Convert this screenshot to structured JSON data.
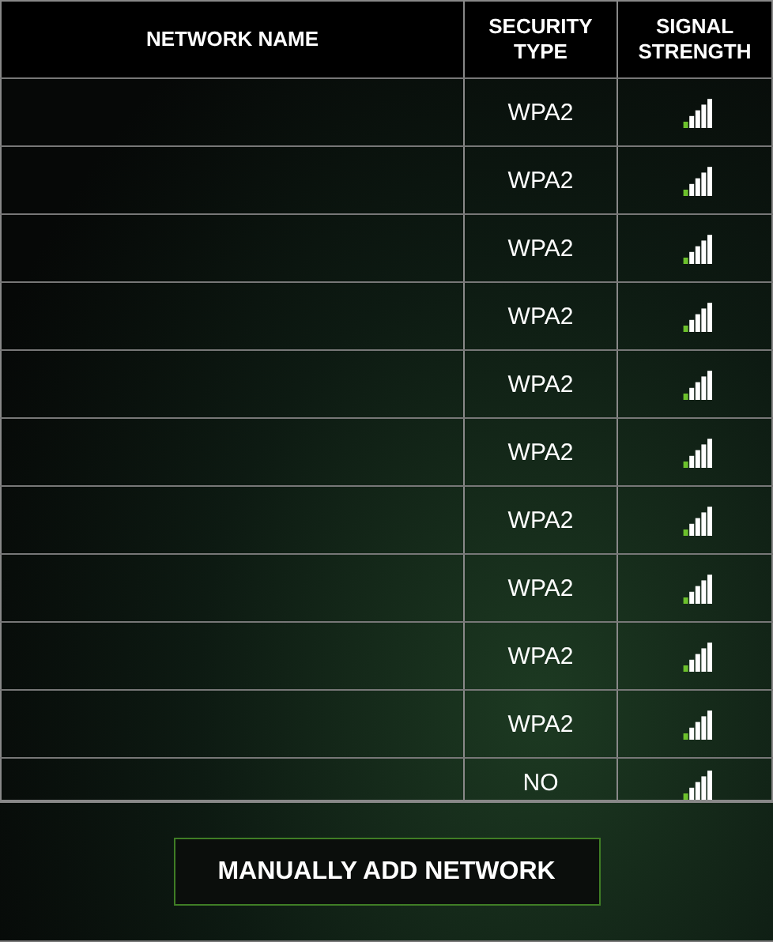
{
  "table": {
    "columns": [
      "NETWORK NAME",
      "SECURITY TYPE",
      "SIGNAL STRENGTH"
    ],
    "rows": [
      {
        "security": "WPA2"
      },
      {
        "security": "WPA2"
      },
      {
        "security": "WPA2"
      },
      {
        "security": "WPA2"
      },
      {
        "security": "WPA2"
      },
      {
        "security": "WPA2"
      },
      {
        "security": "WPA2"
      },
      {
        "security": "WPA2"
      },
      {
        "security": "WPA2"
      },
      {
        "security": "WPA2"
      },
      {
        "security": "NO"
      }
    ]
  },
  "button": {
    "label": "MANUALLY ADD NETWORK"
  }
}
